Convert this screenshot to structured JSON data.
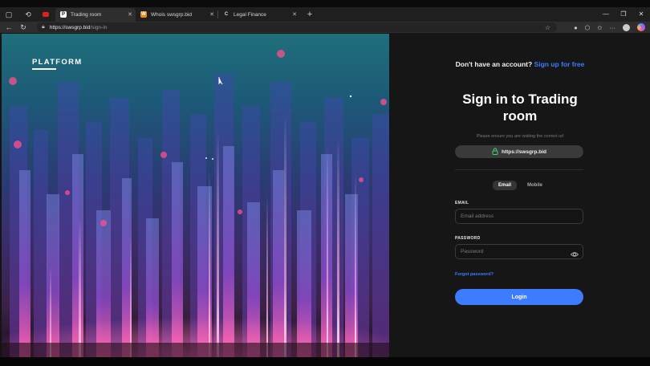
{
  "browser": {
    "tabs": [
      {
        "label": "Trading room",
        "favicon": "P",
        "active": true
      },
      {
        "label": "Whois swsgrp.bid",
        "favicon": "W",
        "active": false
      },
      {
        "label": "Legal Finance",
        "favicon": "C",
        "active": false
      }
    ],
    "new_tab_label": "+",
    "url": {
      "host": "https://swsgrp.bid",
      "path": "/sign-in"
    }
  },
  "hero": {
    "logo": "PLATFORM"
  },
  "panel": {
    "signup_question": "Don't have an account?",
    "signup_link": "Sign up for free",
    "title_line1": "Sign in to Trading",
    "title_line2": "room",
    "notice": "Please ensure you are visiting the correct url",
    "verified_url": "https://swsgrp.bid",
    "methods": [
      {
        "label": "Email",
        "active": true
      },
      {
        "label": "Mobile",
        "active": false
      }
    ],
    "email_label": "EMAIL",
    "email_placeholder": "Email address",
    "password_label": "PASSWORD",
    "password_placeholder": "Password",
    "forgot_label": "Forgot password?",
    "login_label": "Login"
  },
  "colors": {
    "accent": "#3d7bff",
    "lock_green": "#3bd46e",
    "panel_bg": "#161616"
  }
}
